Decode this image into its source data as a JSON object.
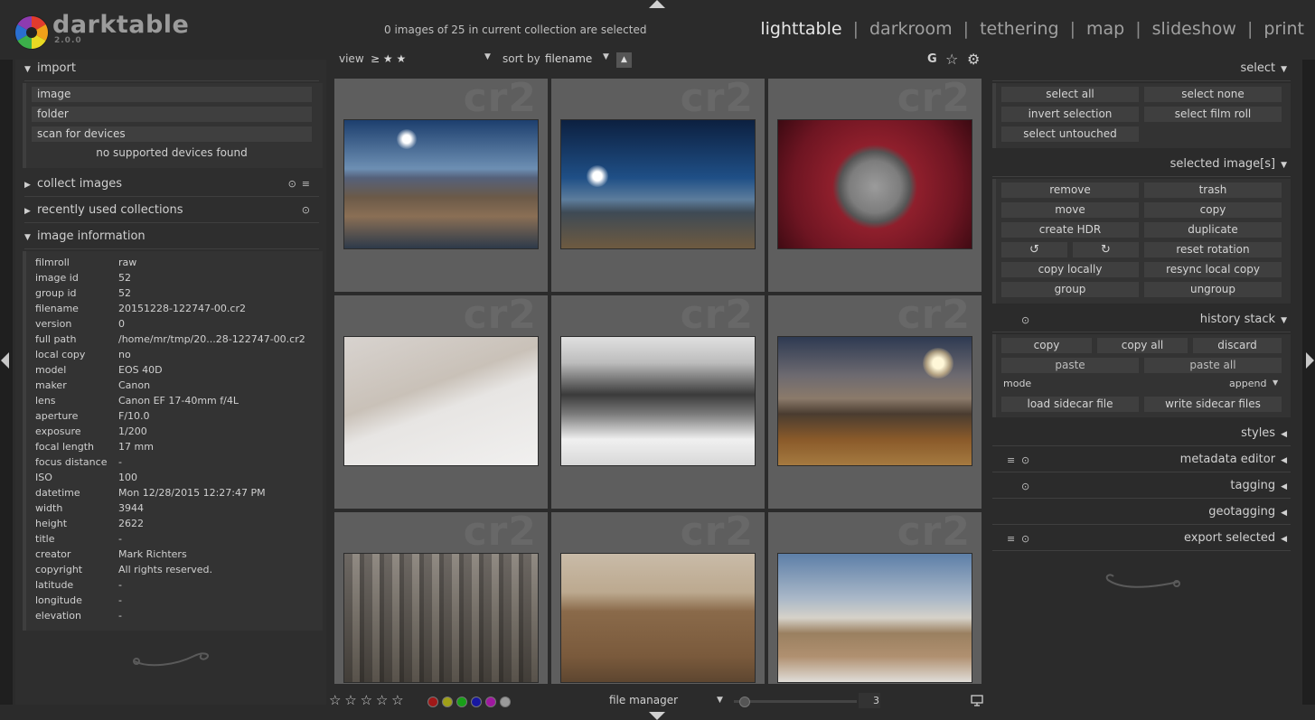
{
  "app": {
    "name": "darktable",
    "version": "2.0.0"
  },
  "status": {
    "selection": "0 images of 25 in current collection are selected"
  },
  "views": {
    "items": [
      "lighttable",
      "darkroom",
      "tethering",
      "map",
      "slideshow",
      "print"
    ],
    "active": "lighttable",
    "separator": "|"
  },
  "filterbar": {
    "view_label": "view",
    "view_value": "≥ ★ ★",
    "sort_label": "sort by",
    "sort_value": "filename",
    "grouping_label": "G"
  },
  "left": {
    "import": {
      "title": "import",
      "buttons": [
        "image",
        "folder",
        "scan for devices"
      ],
      "devices_status": "no supported devices found"
    },
    "collect_images": {
      "title": "collect images"
    },
    "recent_collections": {
      "title": "recently used collections"
    },
    "image_information": {
      "title": "image information",
      "rows": [
        {
          "key": "filmroll",
          "value": "raw"
        },
        {
          "key": "image id",
          "value": "52"
        },
        {
          "key": "group id",
          "value": "52"
        },
        {
          "key": "filename",
          "value": "20151228-122747-00.cr2"
        },
        {
          "key": "version",
          "value": "0"
        },
        {
          "key": "full path",
          "value": "/home/mr/tmp/20...28-122747-00.cr2"
        },
        {
          "key": "local copy",
          "value": "no"
        },
        {
          "key": "model",
          "value": "EOS 40D"
        },
        {
          "key": "maker",
          "value": "Canon"
        },
        {
          "key": "lens",
          "value": "Canon EF 17-40mm f/4L"
        },
        {
          "key": "aperture",
          "value": "F/10.0"
        },
        {
          "key": "exposure",
          "value": "1/200"
        },
        {
          "key": "focal length",
          "value": "17 mm"
        },
        {
          "key": "focus distance",
          "value": "-"
        },
        {
          "key": "ISO",
          "value": "100"
        },
        {
          "key": "datetime",
          "value": "Mon 12/28/2015 12:27:47 PM"
        },
        {
          "key": "width",
          "value": "3944"
        },
        {
          "key": "height",
          "value": "2622"
        },
        {
          "key": "title",
          "value": "-"
        },
        {
          "key": "creator",
          "value": "Mark Richters"
        },
        {
          "key": "copyright",
          "value": "All rights reserved."
        },
        {
          "key": "latitude",
          "value": "-"
        },
        {
          "key": "longitude",
          "value": "-"
        },
        {
          "key": "elevation",
          "value": "-"
        }
      ]
    }
  },
  "grid": {
    "watermark": "cr2",
    "thumbnails": [
      {
        "subject": "sunny winter river reflection"
      },
      {
        "subject": "sun over mountains blue sky"
      },
      {
        "subject": "red hydrant cap"
      },
      {
        "subject": "snowy slope hikers"
      },
      {
        "subject": "black and white snowy peaks"
      },
      {
        "subject": "sunset chapel by lake"
      },
      {
        "subject": "city aerial view"
      },
      {
        "subject": "foggy road with fence"
      },
      {
        "subject": "winter trees meadow"
      }
    ]
  },
  "bottom": {
    "layout_value": "file manager",
    "zoom_value": "3",
    "color_labels": [
      "#a01818",
      "#a0a018",
      "#18a018",
      "#1818a0",
      "#a018a0",
      "#9a9a9a"
    ]
  },
  "right": {
    "select": {
      "title": "select",
      "buttons": [
        "select all",
        "select none",
        "invert selection",
        "select film roll",
        "select untouched"
      ]
    },
    "selected_images": {
      "title": "selected image[s]",
      "buttons": [
        "remove",
        "trash",
        "move",
        "copy",
        "create HDR",
        "duplicate",
        "reset rotation",
        "copy locally",
        "resync local copy",
        "group",
        "ungroup"
      ]
    },
    "history_stack": {
      "title": "history stack",
      "buttons": [
        "copy",
        "copy all",
        "discard",
        "paste",
        "paste all"
      ],
      "mode_label": "mode",
      "mode_value": "append",
      "sidecar_buttons": [
        "load sidecar file",
        "write sidecar files"
      ]
    },
    "collapsed_modules": [
      "styles",
      "metadata editor",
      "tagging",
      "geotagging",
      "export selected"
    ]
  }
}
